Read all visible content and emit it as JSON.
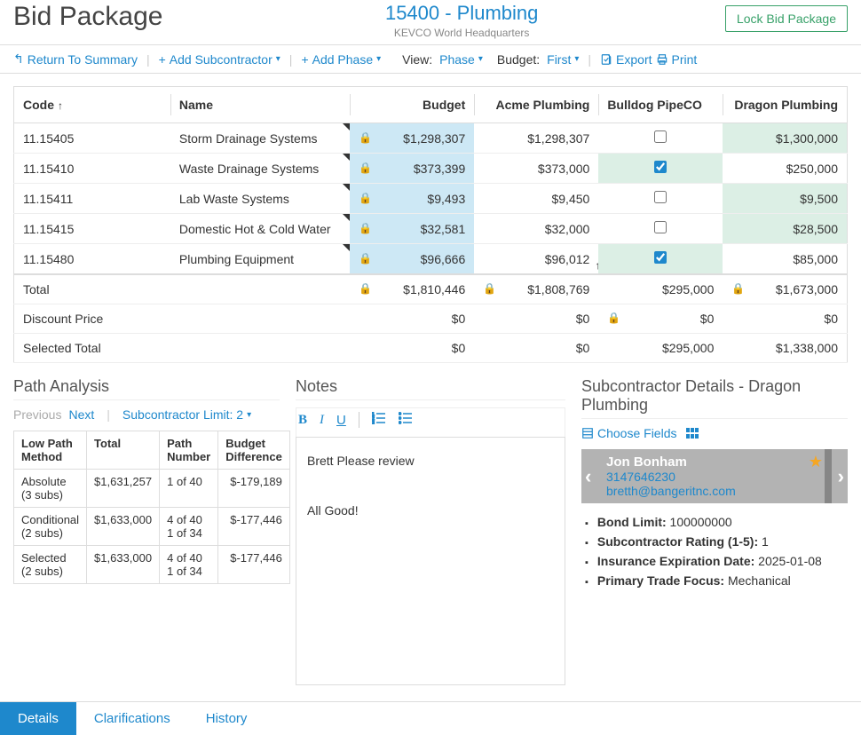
{
  "header": {
    "page_title": "Bid Package",
    "project_code": "15400 - Plumbing",
    "project_sub": "KEVCO World Headquarters",
    "lock_button": "Lock Bid Package"
  },
  "toolbar": {
    "return": "Return To Summary",
    "add_sub": "Add Subcontractor",
    "add_phase": "Add Phase",
    "view_label": "View:",
    "view_value": "Phase",
    "budget_label": "Budget:",
    "budget_value": "First",
    "export": "Export",
    "print": "Print"
  },
  "table": {
    "headers": {
      "code": "Code",
      "name": "Name",
      "budget": "Budget",
      "sub1": "Acme Plumbing",
      "sub2": "Bulldog PipeCO",
      "sub3": "Dragon Plumbing"
    },
    "rows": [
      {
        "code": "11.15405",
        "name": "Storm Drainage Systems",
        "budget": "$1,298,307",
        "sub1": "$1,298,307",
        "sub2_checked": false,
        "sub3": "$1,300,000",
        "sub3_green": true
      },
      {
        "code": "11.15410",
        "name": "Waste Drainage Systems",
        "budget": "$373,399",
        "sub1": "$373,000",
        "sub2_checked": true,
        "sub3": "$250,000",
        "sub3_green": false
      },
      {
        "code": "11.15411",
        "name": "Lab Waste Systems",
        "budget": "$9,493",
        "sub1": "$9,450",
        "sub2_checked": false,
        "sub3": "$9,500",
        "sub3_green": true
      },
      {
        "code": "11.15415",
        "name": "Domestic Hot & Cold Water",
        "budget": "$32,581",
        "sub1": "$32,000",
        "sub2_checked": false,
        "sub3": "$28,500",
        "sub3_green": true
      },
      {
        "code": "11.15480",
        "name": "Plumbing Equipment",
        "budget": "$96,666",
        "sub1": "$96,012",
        "sub1_arrow": true,
        "sub2_checked": true,
        "sub3": "$85,000",
        "sub3_green": false
      }
    ],
    "totals": {
      "total_label": "Total",
      "total_budget": "$1,810,446",
      "total_sub1": "$1,808,769",
      "total_sub2": "$295,000",
      "total_sub3": "$1,673,000",
      "discount_label": "Discount Price",
      "discount_budget": "$0",
      "discount_sub1": "$0",
      "discount_sub2": "$0",
      "discount_sub3": "$0",
      "selected_label": "Selected Total",
      "selected_budget": "$0",
      "selected_sub1": "$0",
      "selected_sub2": "$295,000",
      "selected_sub3": "$1,338,000"
    }
  },
  "path": {
    "title": "Path Analysis",
    "prev": "Previous",
    "next": "Next",
    "limit_label": "Subcontractor Limit: 2",
    "headers": {
      "method": "Low Path Method",
      "total": "Total",
      "number": "Path Number",
      "diff": "Budget Difference"
    },
    "rows": [
      {
        "method": "Absolute (3 subs)",
        "total": "$1,631,257",
        "number": "1 of 40",
        "diff": "$-179,189"
      },
      {
        "method": "Conditional (2 subs)",
        "total": "$1,633,000",
        "number": "4 of 40\n1 of 34",
        "diff": "$-177,446"
      },
      {
        "method": "Selected (2 subs)",
        "total": "$1,633,000",
        "number": "4 of 40\n1 of 34",
        "diff": "$-177,446"
      }
    ]
  },
  "notes": {
    "title": "Notes",
    "line1": "Brett Please review",
    "line2": "All Good!"
  },
  "sub": {
    "title": "Subcontractor Details - Dragon Plumbing",
    "choose_fields": "Choose Fields",
    "contact": {
      "name": "Jon Bonham",
      "phone": "3147646230",
      "email": "bretth@bangeritnc.com"
    },
    "details": [
      {
        "label": "Bond Limit:",
        "value": "100000000"
      },
      {
        "label": "Subcontractor Rating (1-5):",
        "value": "1"
      },
      {
        "label": "Insurance Expiration Date:",
        "value": "2025-01-08"
      },
      {
        "label": "Primary Trade Focus:",
        "value": "Mechanical"
      }
    ]
  },
  "tabs": {
    "details": "Details",
    "clarifications": "Clarifications",
    "history": "History"
  }
}
